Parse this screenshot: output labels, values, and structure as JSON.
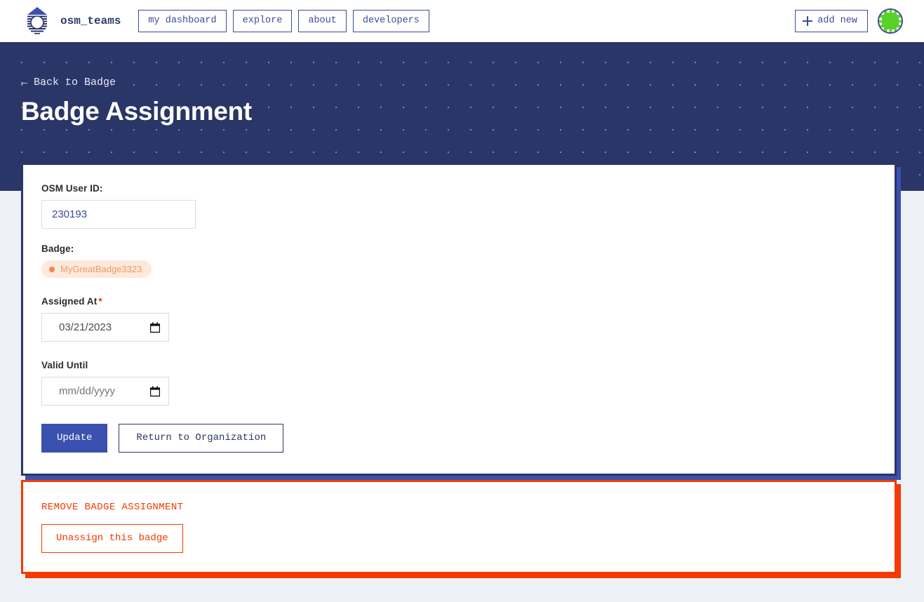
{
  "header": {
    "brand_name": "osm_teams",
    "logo_icon": "osm-teams-logo-icon",
    "nav": [
      {
        "label": "my dashboard",
        "name": "nav-my-dashboard"
      },
      {
        "label": "explore",
        "name": "nav-explore"
      },
      {
        "label": "about",
        "name": "nav-about"
      },
      {
        "label": "developers",
        "name": "nav-developers"
      }
    ],
    "add_new_label": "add new",
    "add_new_icon": "plus-icon",
    "avatar_icon": "user-avatar-identicon",
    "avatar_color": "#5ad02b"
  },
  "hero": {
    "back_link": "← Back to Badge",
    "title": "Badge Assignment",
    "background_color": "#2a3568"
  },
  "form": {
    "user_id": {
      "label": "OSM User ID:",
      "value": "230193"
    },
    "badge": {
      "label": "Badge:",
      "pill_text": "MyGreatBadge3323",
      "pill_bg": "#fdeadc",
      "pill_color": "#ef9a62"
    },
    "assigned_at": {
      "label": "Assigned At",
      "required_marker": "*",
      "value": "03/21/2023",
      "calendar_icon": "calendar-icon"
    },
    "valid_until": {
      "label": "Valid Until",
      "value": "",
      "placeholder": "mm/dd/yyyy",
      "calendar_icon": "calendar-icon"
    },
    "update_label": "Update",
    "return_label": "Return to Organization",
    "accent_color": "#3b51b0"
  },
  "danger_zone": {
    "title": "REMOVE BADGE ASSIGNMENT",
    "button_label": "Unassign this badge",
    "color": "#f53900"
  }
}
